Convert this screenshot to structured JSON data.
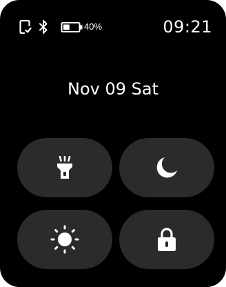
{
  "status_bar": {
    "battery_percent": "40%",
    "battery_level": 0.4,
    "time": "09:21",
    "icons": [
      "notification-phone-icon",
      "bluetooth-icon",
      "battery-icon"
    ]
  },
  "date": "Nov 09 Sat",
  "tiles": [
    {
      "icon": "flashlight-icon"
    },
    {
      "icon": "moon-icon"
    },
    {
      "icon": "brightness-icon"
    },
    {
      "icon": "lock-icon"
    }
  ],
  "colors": {
    "background": "#000000",
    "tile": "#2b2b2b",
    "foreground": "#ffffff"
  }
}
